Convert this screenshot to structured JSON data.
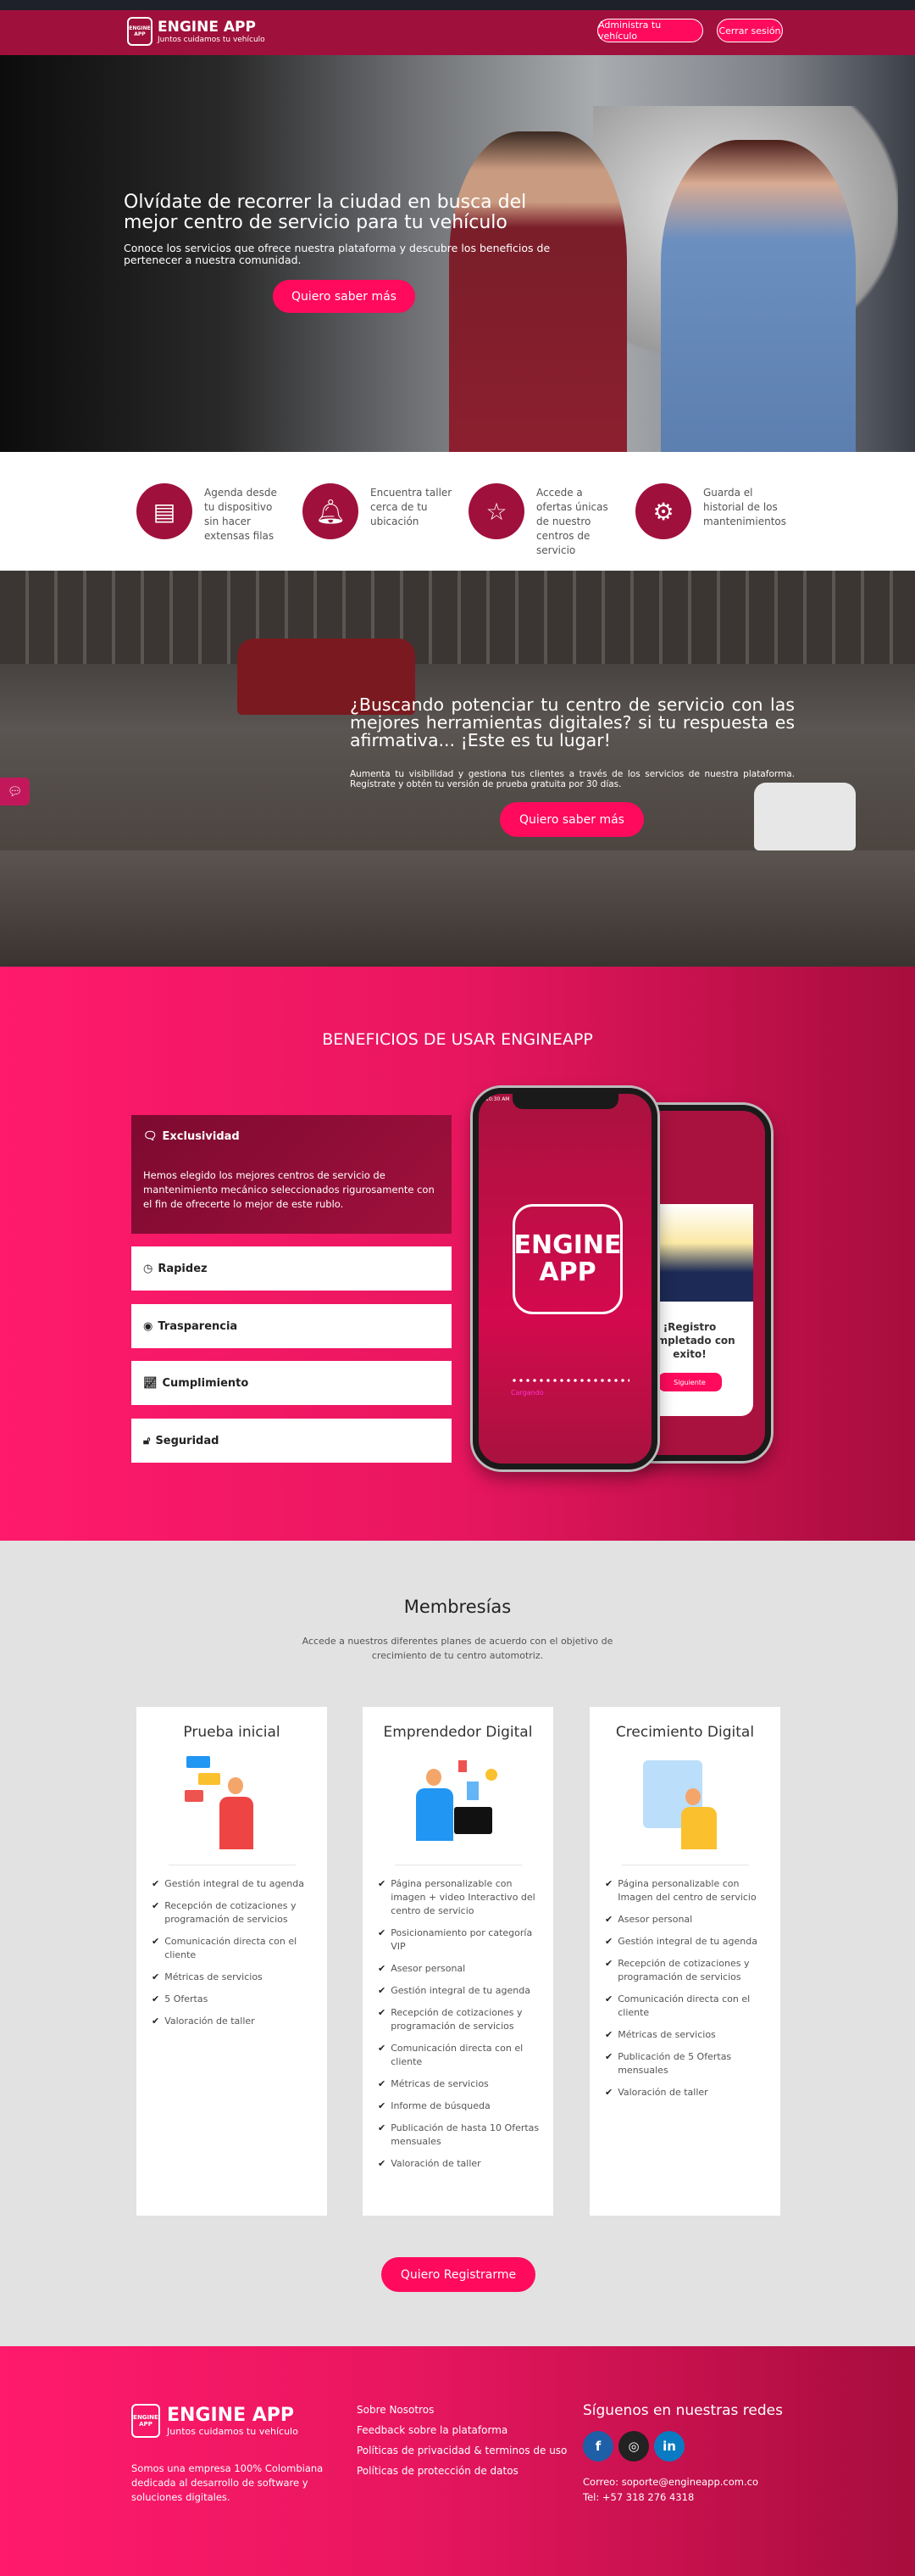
{
  "header": {
    "brand": "ENGINE APP",
    "tagline": "Juntos cuidamos tu vehículo",
    "logo_text": "ENGINE APP",
    "btn_manage": "Administra tu vehículo",
    "btn_logout": "Cerrar sesión"
  },
  "hero": {
    "title": "Olvídate de recorrer la ciudad en busca del mejor centro de servicio para tu vehículo",
    "subtitle": "Conoce los servicios que ofrece nuestra plataforma y descubre los beneficios de pertenecer a nuestra comunidad.",
    "cta": "Quiero saber más"
  },
  "features": [
    {
      "icon": "calendar-icon",
      "text": "Agenda desde tu dispositivo sin hacer extensas filas"
    },
    {
      "icon": "bell-icon",
      "text": "Encuentra taller cerca de tu ubicación"
    },
    {
      "icon": "star-icon",
      "text": "Accede a ofertas únicas de nuestro centros de servicio"
    },
    {
      "icon": "gear-target-icon",
      "text": "Guarda el historial de los mantenimientos"
    }
  ],
  "hero2": {
    "title": "¿Buscando potenciar tu centro de servicio con las mejores herramientas digitales? si tu respuesta es afirmativa... ¡Este es tu lugar!",
    "subtitle": "Aumenta tu visibilidad y gestiona tus clientes a través de los servicios de nuestra plataforma. Regístrate y obtén tu versión de prueba gratuita por 30 días.",
    "cta": "Quiero saber más"
  },
  "benefits": {
    "title": "BENEFICIOS DE USAR ENGINEAPP",
    "items": [
      {
        "label": "Exclusividad",
        "icon": "chat-icon",
        "expanded": true,
        "body": "Hemos elegido los mejores centros de servicio de mantenimiento mecánico seleccionados rigurosamente con el fin de ofrecerte lo mejor de este rublo."
      },
      {
        "label": "Rapidez",
        "icon": "clock-icon"
      },
      {
        "label": "Trasparencia",
        "icon": "eye-icon"
      },
      {
        "label": "Cumplimiento",
        "icon": "chart-icon"
      },
      {
        "label": "Seguridad",
        "icon": "lock-icon"
      }
    ],
    "phone1": {
      "time": "10:30 AM",
      "logo": "ENGINE APP",
      "loading": "Cargando"
    },
    "phone2": {
      "message": "¡Registro completado con exito!",
      "button": "Siguiente"
    }
  },
  "membership": {
    "title": "Membresías",
    "subtitle": "Accede a nuestros diferentes planes de acuerdo con el objetivo de crecimiento de tu centro automotriz.",
    "plans": [
      {
        "name": "Prueba inicial",
        "features": [
          "Gestión integral de tu agenda",
          "Recepción de cotizaciones y programación de servicios",
          "Comunicación directa con el cliente",
          "Métricas de servicios",
          "5 Ofertas",
          "Valoración de taller"
        ]
      },
      {
        "name": "Emprendedor Digital",
        "features": [
          "Página personalizable con imagen + video Interactivo del centro de servicio",
          "Posicionamiento por categoría VIP",
          "Asesor personal",
          "Gestión integral de tu agenda",
          "Recepción de cotizaciones y programación de servicios",
          "Comunicación directa con el cliente",
          "Métricas de servicios",
          "Informe de búsqueda",
          "Publicación de hasta 10 Ofertas mensuales",
          "Valoración de taller"
        ]
      },
      {
        "name": "Crecimiento Digital",
        "features": [
          "Página personalizable con Imagen del centro de servicio",
          "Asesor personal",
          "Gestión integral de tu agenda",
          "Recepción de cotizaciones y programación de servicios",
          "Comunicación directa con el cliente",
          "Métricas de servicios",
          "Publicación de 5 Ofertas mensuales",
          "Valoración de taller"
        ]
      }
    ],
    "cta": "Quiero Registrarme"
  },
  "footer": {
    "brand": "ENGINE APP",
    "tagline": "Juntos cuidamos tu vehículo",
    "about": "Somos una empresa 100% Colombiana dedicada al desarrollo de software y soluciones digitales.",
    "links": [
      "Sobre Nosotros",
      "Feedback sobre la plataforma",
      "Políticas de privacidad & terminos de uso",
      "Políticas de protección de datos"
    ],
    "social_title": "Síguenos en nuestras redes",
    "social": [
      {
        "name": "facebook",
        "color": "#1e5fa8"
      },
      {
        "name": "instagram",
        "color": "#222222"
      },
      {
        "name": "linkedin",
        "color": "#0a7bc2"
      }
    ],
    "email": "Correo: soporte@engineapp.com.co",
    "phone": "Tel: +57 318 276 4318"
  },
  "colors": {
    "brand_dark": "#a0103d",
    "accent": "#ff0a5c",
    "pink": "#ff1a6b"
  }
}
